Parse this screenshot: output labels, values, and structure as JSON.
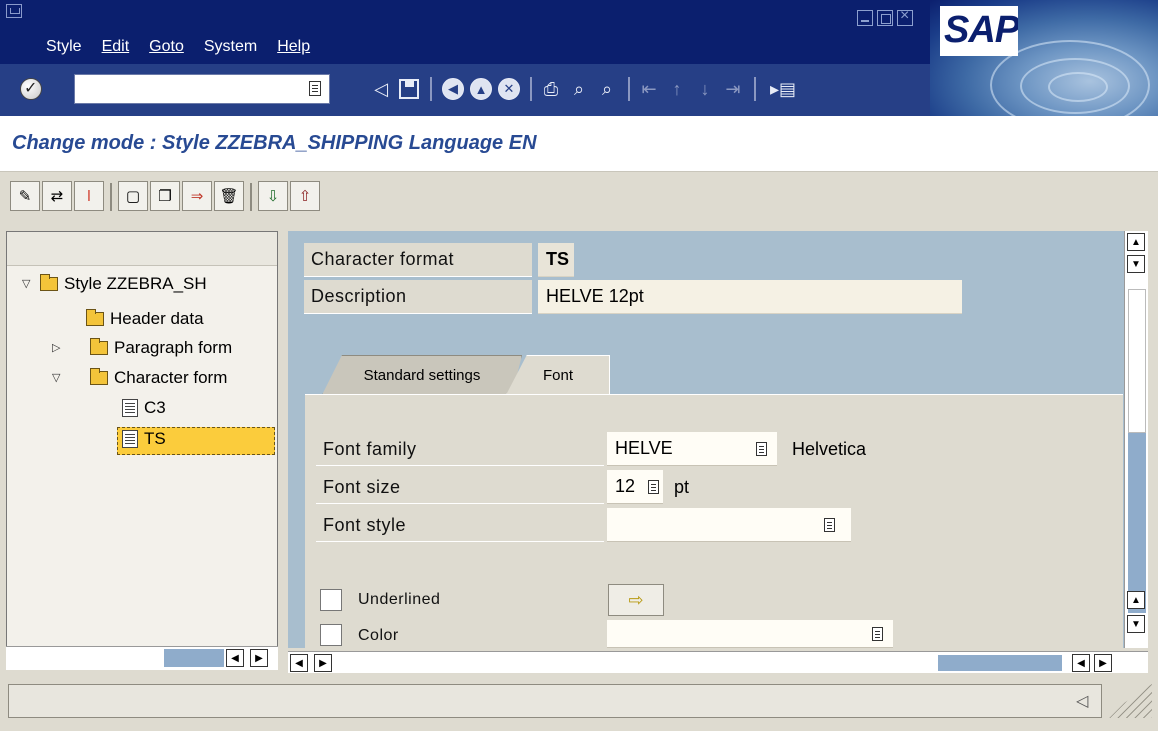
{
  "menu": {
    "items": [
      {
        "label": "Style",
        "u": ""
      },
      {
        "label": "Edit",
        "u": ""
      },
      {
        "label": "Goto",
        "u": ""
      },
      {
        "label": "System",
        "u": ""
      },
      {
        "label": "Help",
        "u": ""
      }
    ]
  },
  "logo": {
    "text": "SAP"
  },
  "toolbar": {
    "command_value": "",
    "icons": [
      "enter-icon",
      "back-arrow-icon",
      "save-icon",
      "back-icon",
      "exit-icon",
      "cancel-icon",
      "print-icon",
      "find-icon",
      "find-next-icon",
      "first-page-icon",
      "previous-page-icon",
      "next-page-icon",
      "last-page-icon",
      "new-session-icon"
    ]
  },
  "title": "Change mode : Style ZZEBRA_SHIPPING Language EN",
  "app_toolbar": {
    "icons": [
      "edit-pen-icon",
      "display-change-icon",
      "info-icon",
      "create-icon",
      "copy-icon",
      "transport-icon",
      "delete-icon",
      "import-icon",
      "export-icon"
    ]
  },
  "tree": {
    "root": "Style ZZEBRA_SH",
    "header": "Header data",
    "paragraph": "Paragraph form",
    "character": "Character form",
    "c3": "C3",
    "ts": "TS"
  },
  "detail": {
    "char_format_label": "Character format",
    "char_format_value": "TS",
    "description_label": "Description",
    "description_value": "HELVE 12pt",
    "tab_standard": "Standard settings",
    "tab_font": "Font",
    "font_family_label": "Font family",
    "font_family_value": "HELVE",
    "font_family_desc": "Helvetica",
    "font_size_label": "Font size",
    "font_size_value": "12",
    "font_size_unit": "pt",
    "font_style_label": "Font style",
    "font_style_value": "",
    "underlined_label": "Underlined",
    "color_label": "Color"
  },
  "colors": {
    "menubar": "#0b1f6e",
    "title_text": "#284a93",
    "selection": "#fbcc3c",
    "panel_bg": "#a8bece"
  }
}
